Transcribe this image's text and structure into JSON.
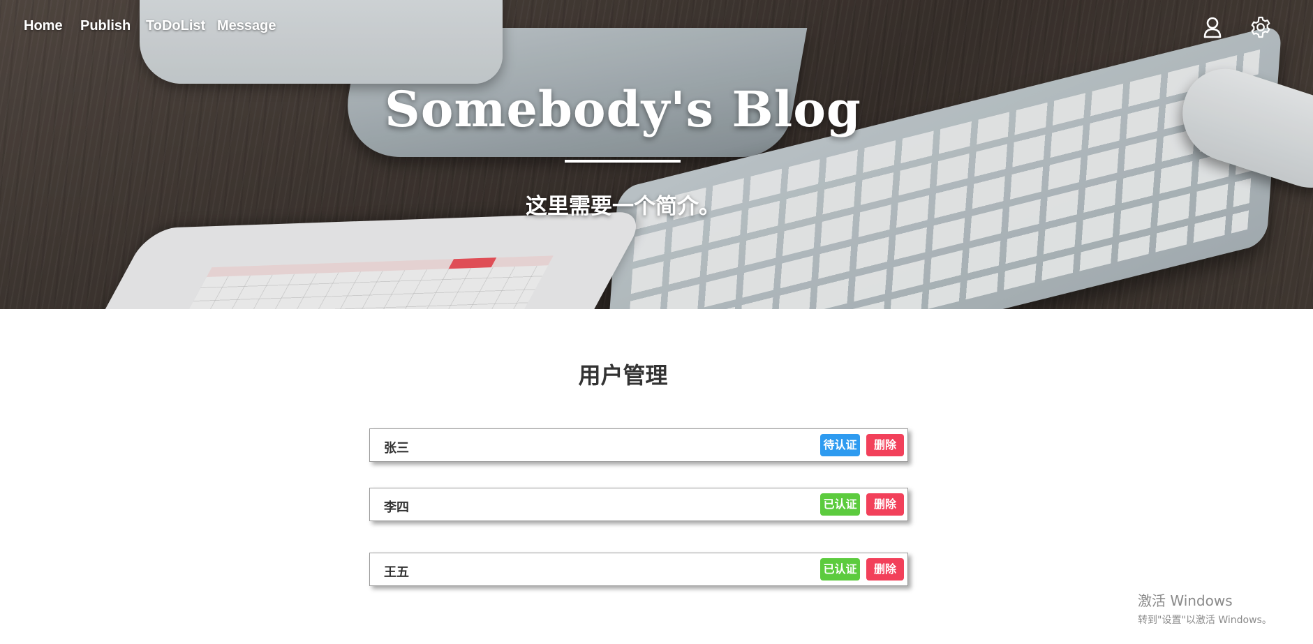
{
  "nav": {
    "links": [
      {
        "label": "Home"
      },
      {
        "label": "Publish"
      },
      {
        "label": "ToDoList"
      },
      {
        "label": "Message"
      }
    ],
    "icons": {
      "user": "user-icon",
      "settings": "gear-icon"
    }
  },
  "hero": {
    "title": "Somebody's Blog",
    "subtitle": "这里需要一个简介。"
  },
  "main": {
    "title": "用户管理",
    "users": [
      {
        "name": "张三",
        "status": "待认证",
        "status_color": "#2e9bf0",
        "delete_label": "删除"
      },
      {
        "name": "李四",
        "status": "已认证",
        "status_color": "#5ccb3e",
        "delete_label": "删除"
      },
      {
        "name": "王五",
        "status": "已认证",
        "status_color": "#5ccb3e",
        "delete_label": "删除"
      }
    ]
  },
  "watermark": {
    "line1": "激活 Windows",
    "line2": "转到\"设置\"以激活 Windows。"
  },
  "colors": {
    "delete": "#f2405a",
    "pending": "#2e9bf0",
    "verified": "#5ccb3e"
  }
}
